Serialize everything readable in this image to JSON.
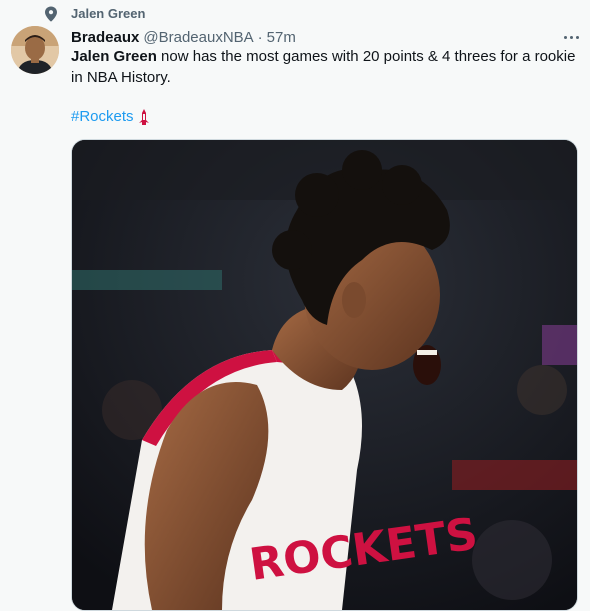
{
  "context": {
    "icon": "location-pin-icon",
    "label": "Jalen Green"
  },
  "tweet": {
    "author": {
      "display_name": "Bradeaux",
      "handle": "@BradeauxNBA",
      "avatar": "avatar"
    },
    "separator": "·",
    "time": "57m",
    "text_mention": "Jalen Green",
    "text_body": " now has the most games with 20 points & 4 threes for a rookie in NBA History.",
    "hashtag": "#Rockets",
    "hashflag_icon": "rockets-logo-icon",
    "media": {
      "alt_icon": "basketball-player-photo",
      "jersey_text": "ROCKETS"
    }
  },
  "colors": {
    "accent": "#1d9bf0",
    "secondary_text": "#536471",
    "rockets_red": "#ce1141"
  }
}
